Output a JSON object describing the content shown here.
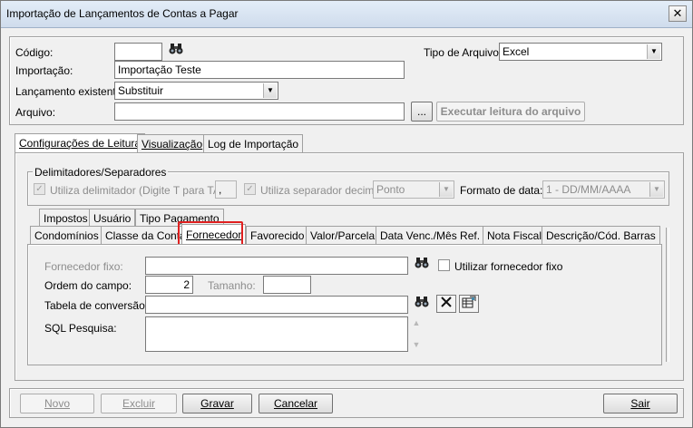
{
  "window": {
    "title": "Importação de Lançamentos de Contas a Pagar",
    "close_glyph": "✕"
  },
  "header": {
    "codigo_label": "Código:",
    "codigo_value": "",
    "tipo_arquivo_label": "Tipo de Arquivo:",
    "tipo_arquivo_value": "Excel",
    "importacao_label": "Importação:",
    "importacao_value": "Importação Teste",
    "lancamento_label": "Lançamento existente:",
    "lancamento_value": "Substituir",
    "arquivo_label": "Arquivo:",
    "arquivo_value": "",
    "browse_label": "...",
    "executar_label": "Executar leitura do arquivo"
  },
  "main_tabs": [
    {
      "label": "Configurações de Leitura"
    },
    {
      "label": "Visualização"
    },
    {
      "label": "Log de Importação"
    }
  ],
  "delimitadores": {
    "group_title": "Delimitadores/Separadores",
    "utiliza_delimitador_label": "Utiliza delimitador (Digite T para TAB)",
    "delimitador_value": ",",
    "utiliza_separador_label": "Utiliza separador decimal",
    "separador_value": "Ponto",
    "formato_data_label": "Formato de data:",
    "formato_data_value": "1 - DD/MM/AAAA"
  },
  "sub_tabs_row1": [
    {
      "label": "Impostos"
    },
    {
      "label": "Usuário"
    },
    {
      "label": "Tipo Pagamento"
    }
  ],
  "sub_tabs_row2": [
    {
      "label": "Condomínios"
    },
    {
      "label": "Classe da Conta"
    },
    {
      "label": "Fornecedor"
    },
    {
      "label": "Favorecido"
    },
    {
      "label": "Valor/Parcela"
    },
    {
      "label": "Data Venc./Mês Ref."
    },
    {
      "label": "Nota Fiscal"
    },
    {
      "label": "Descrição/Cód. Barras"
    }
  ],
  "fornecedor": {
    "fornecedor_fixo_label": "Fornecedor fixo:",
    "fornecedor_fixo_value": "",
    "utilizar_fixo_label": "Utilizar fornecedor fixo",
    "ordem_label": "Ordem do campo:",
    "ordem_value": "2",
    "tamanho_label": "Tamanho:",
    "tamanho_value": "",
    "tabela_label": "Tabela de conversão:",
    "tabela_value": "",
    "sql_label": "SQL Pesquisa:",
    "sql_value": ""
  },
  "footer": {
    "novo_label": "Novo",
    "excluir_label": "Excluir",
    "gravar_label": "Gravar",
    "cancelar_label": "Cancelar",
    "sair_label": "Sair"
  },
  "colors": {
    "highlight_border": "#e02020",
    "title_bar": "#dbe6f4"
  },
  "icons": [
    "binoculars-icon",
    "close-x-icon",
    "edit-table-icon",
    "chevron-down-icon",
    "checkmark-icon"
  ]
}
